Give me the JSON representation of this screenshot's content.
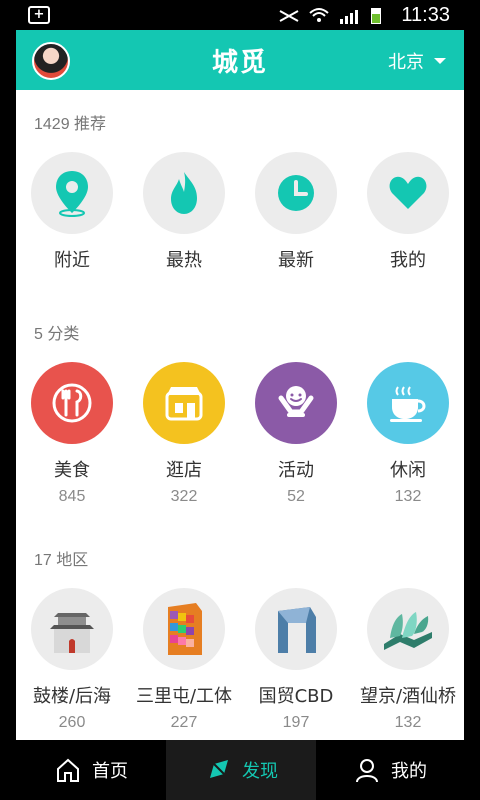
{
  "status_bar": {
    "time": "11:33"
  },
  "header": {
    "brand": "城觅",
    "city": "北京"
  },
  "sections": {
    "recommend": {
      "title": "1429 推荐"
    },
    "categories": {
      "title": "5 分类"
    },
    "regions": {
      "title": "17 地区"
    }
  },
  "recommend_items": [
    {
      "label": "附近",
      "icon": "location-pin-icon"
    },
    {
      "label": "最热",
      "icon": "flame-icon"
    },
    {
      "label": "最新",
      "icon": "clock-icon"
    },
    {
      "label": "我的",
      "icon": "heart-icon"
    }
  ],
  "category_items": [
    {
      "label": "美食",
      "count": "845",
      "icon": "food-spoon-fork-icon",
      "color": "#e8534d"
    },
    {
      "label": "逛店",
      "count": "322",
      "icon": "store-awning-icon",
      "color": "#f4c21f"
    },
    {
      "label": "活动",
      "count": "52",
      "icon": "smile-person-icon",
      "color": "#8b5aa7"
    },
    {
      "label": "休闲",
      "count": "132",
      "icon": "coffee-cup-icon",
      "color": "#56c9e6"
    }
  ],
  "region_items": [
    {
      "label": "鼓楼/后海",
      "count": "260",
      "icon": "drum-tower-icon"
    },
    {
      "label": "三里屯/工体",
      "count": "227",
      "icon": "colorful-building-icon"
    },
    {
      "label": "国贸CBD",
      "count": "197",
      "icon": "cctv-tower-icon"
    },
    {
      "label": "望京/酒仙桥",
      "count": "132",
      "icon": "wangjing-soho-icon"
    }
  ],
  "bottom_nav": {
    "home": "首页",
    "discover": "发现",
    "mine": "我的"
  },
  "colors": {
    "accent": "#14c7b2"
  }
}
